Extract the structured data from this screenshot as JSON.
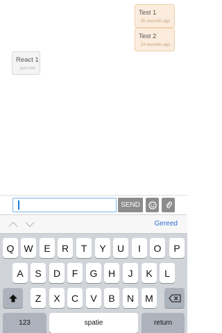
{
  "messages": [
    {
      "text": "Test 1",
      "time": "35 seconds ago",
      "side": "out"
    },
    {
      "text": "Test 2",
      "time": "24 seconds ago",
      "side": "out"
    },
    {
      "text": "React 1",
      "time": "just now",
      "side": "in"
    }
  ],
  "composer": {
    "input_value": "",
    "send_label": "SEND",
    "emoji_icon": "smiley-icon",
    "attach_icon": "paperclip-icon"
  },
  "accessory": {
    "done_label": "Gereed"
  },
  "keyboard": {
    "row1": [
      "Q",
      "W",
      "E",
      "R",
      "T",
      "Y",
      "U",
      "I",
      "O",
      "P"
    ],
    "row2": [
      "A",
      "S",
      "D",
      "F",
      "G",
      "H",
      "J",
      "K",
      "L"
    ],
    "row3": [
      "Z",
      "X",
      "C",
      "V",
      "B",
      "N",
      "M"
    ],
    "numbers_label": "123",
    "space_label": "spatie",
    "return_label": "return"
  },
  "colors": {
    "outgoing_bubble": "#fbecdd",
    "incoming_bubble": "#f4f4f4",
    "accent": "#2f6fd6",
    "send_button": "#8c8c8c"
  }
}
